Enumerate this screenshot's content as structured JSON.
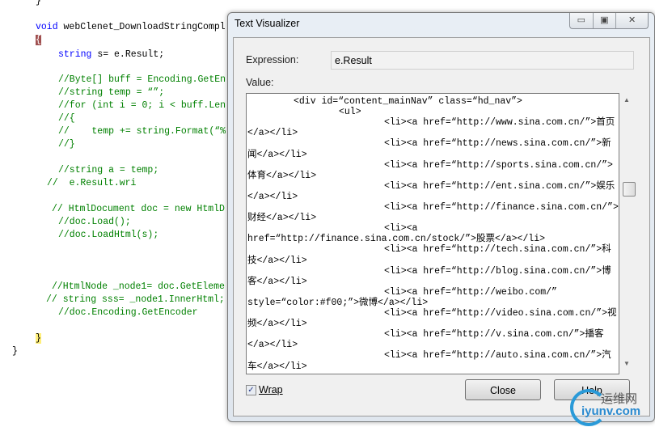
{
  "editor": {
    "lines": [
      "}",
      "void",
      " webClenet_DownloadStringCompl",
      "{",
      "string",
      " s= e.Result;",
      "//Byte[] buff = Encoding.GetEn",
      "//string temp = “”;",
      "//for (int i = 0; i < buff.Len",
      "//{",
      "//    temp += string.Format(“%",
      "//}",
      "//string a = temp;",
      "//  e.Result.wri",
      "// HtmlDocument doc = new HtmlD",
      "//doc.Load();",
      "//doc.LoadHtml(s);",
      "//HtmlNode _node1= doc.GetEleme",
      "// string sss= _node1.InnerHtml;",
      "//doc.Encoding.GetEncoder",
      "}",
      "}"
    ]
  },
  "dialog": {
    "title": "Text Visualizer",
    "controls": {
      "minimize": "▭",
      "maximize": "▣",
      "close": "✕"
    },
    "expression_label": "Expression:",
    "expression_value": "e.Result",
    "value_label": "Value:",
    "value_lines": [
      "<div id=“content_mainNav” class=“hd_nav”>",
      "<ul>",
      "<li><a href=“http://www.sina.com.cn/”>首页",
      "</a></li>",
      "<li><a href=“http://news.sina.com.cn/”>新",
      "闻</a></li>",
      "<li><a href=“http://sports.sina.com.cn/”>",
      "体育</a></li>",
      "<li><a href=“http://ent.sina.com.cn/”>娱乐",
      "</a></li>",
      "<li><a href=“http://finance.sina.com.cn/”>",
      "财经</a></li>",
      "<li><a",
      "href=“http://finance.sina.com.cn/stock/”>股票</a></li>",
      "<li><a href=“http://tech.sina.com.cn/”>科",
      "技</a></li>",
      "<li><a href=“http://blog.sina.com.cn/”>博",
      "客</a></li>",
      "<li><a href=“http://weibo.com/”",
      "style=“color:#f00;”>微博</a></li>",
      "<li><a href=“http://video.sina.com.cn/”>视",
      "频</a></li>",
      "<li><a href=“http://v.sina.com.cn/”>播客",
      "</a></li>",
      "<li><a href=“http://auto.sina.com.cn/”>汽",
      "车</a></li>"
    ],
    "wrap_label": "Wrap",
    "wrap_checked": true,
    "close_label": "Close",
    "help_label": "Help"
  },
  "watermark": {
    "cn": "运维网",
    "en": "iyunv.com"
  },
  "colors": {
    "keyword": "#0000ff",
    "comment": "#008000",
    "accent": "#2a9ad8"
  }
}
